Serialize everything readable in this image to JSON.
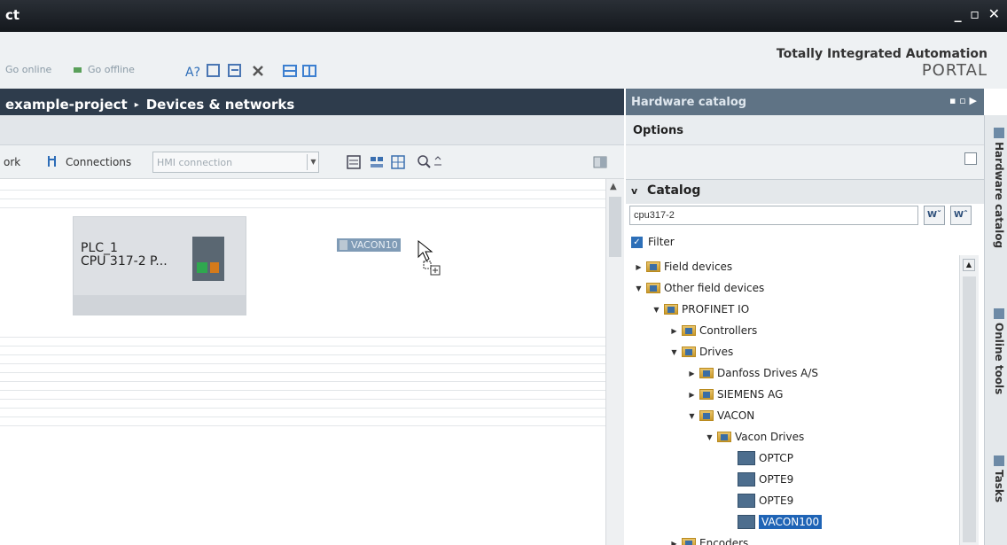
{
  "window": {
    "title": "ct",
    "controls": "_ ▫ ✕"
  },
  "toolbar": {
    "go_online": "Go online",
    "go_offline": "Go offline"
  },
  "brand": {
    "line1": "Totally Integrated Automation",
    "line2": "PORTAL"
  },
  "breadcrumb": {
    "project": "example-project",
    "separator": "▸",
    "section": "Devices & networks"
  },
  "network_bar": {
    "network_label": "ork",
    "connections_label": "Connections",
    "hmi_connection": "HMI connection"
  },
  "canvas": {
    "plc": {
      "name": "PLC_1",
      "cpu": "CPU 317-2 P..."
    },
    "drag_item": "VACON10"
  },
  "hardware_catalog": {
    "header": "Hardware catalog",
    "options_label": "Options",
    "catalog_label": "Catalog",
    "search_value": "cpu317-2",
    "filter_label": "Filter",
    "tree": [
      {
        "label": "Field devices"
      },
      {
        "label": "Other field devices"
      },
      {
        "label": "PROFINET IO"
      },
      {
        "label": "Controllers"
      },
      {
        "label": "Drives"
      },
      {
        "label": "Danfoss Drives A/S"
      },
      {
        "label": "SIEMENS AG"
      },
      {
        "label": "VACON"
      },
      {
        "label": "Vacon Drives"
      },
      {
        "label": "OPTCP"
      },
      {
        "label": "OPTE9"
      },
      {
        "label": "OPTE9"
      },
      {
        "label": "VACON100"
      },
      {
        "label": "Encoders"
      }
    ]
  },
  "side_tabs": {
    "hardware_catalog": "Hardware catalog",
    "online_tools": "Online tools",
    "tasks": "Tasks"
  }
}
